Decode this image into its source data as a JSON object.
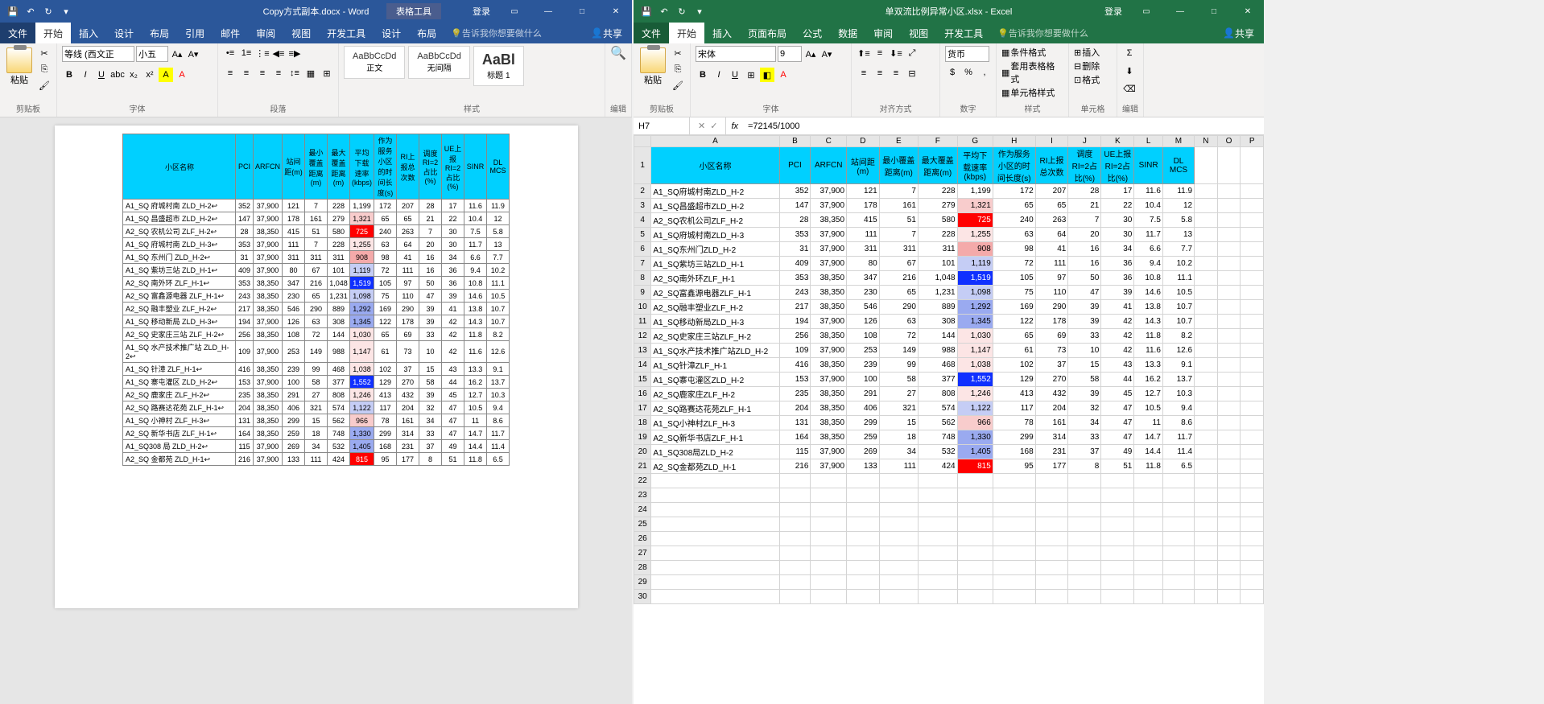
{
  "word": {
    "title": "Copy方式副本.docx - Word",
    "context_tab": "表格工具",
    "login": "登录",
    "menu": {
      "file": "文件",
      "home": "开始",
      "insert": "插入",
      "design": "设计",
      "layout": "布局",
      "references": "引用",
      "mailings": "邮件",
      "review": "审阅",
      "view": "视图",
      "devtools": "开发工具",
      "tbl_design": "设计",
      "tbl_layout": "布局",
      "tell": "告诉我你想要做什么",
      "share": "共享"
    },
    "ribbon": {
      "clipboard": "剪贴板",
      "paste": "粘贴",
      "font": "字体",
      "font_name": "等线 (西文正",
      "font_size": "小五",
      "para": "段落",
      "styles": "样式",
      "editing": "编辑",
      "style_normal_preview": "AaBbCcDd",
      "style_normal": "正文",
      "style_nospace_preview": "AaBbCcDd",
      "style_nospace": "无间隔",
      "style_h1_preview": "AaBl",
      "style_h1": "标题 1"
    }
  },
  "excel": {
    "title": "单双流比例异常小区.xlsx - Excel",
    "login": "登录",
    "menu": {
      "file": "文件",
      "home": "开始",
      "insert": "插入",
      "pagelayout": "页面布局",
      "formulas": "公式",
      "data": "数据",
      "review": "审阅",
      "view": "视图",
      "devtools": "开发工具",
      "tell": "告诉我你想要做什么",
      "share": "共享"
    },
    "ribbon": {
      "clipboard": "剪贴板",
      "paste": "粘贴",
      "font": "字体",
      "font_name": "宋体",
      "font_size": "9",
      "align": "对齐方式",
      "number": "数字",
      "number_fmt": "货币",
      "styles": "样式",
      "cells": "单元格",
      "editing": "编辑",
      "cond_fmt": "条件格式",
      "tbl_fmt": "套用表格格式",
      "cell_style": "单元格样式",
      "ins": "插入",
      "del": "删除",
      "fmt": "格式"
    },
    "name_box": "H7",
    "formula": "=72145/1000",
    "col_letters": [
      "A",
      "B",
      "C",
      "D",
      "E",
      "F",
      "G",
      "H",
      "I",
      "J",
      "K",
      "L",
      "M",
      "N",
      "O",
      "P"
    ]
  },
  "headers": [
    "小区名称",
    "PCI",
    "ARFCN",
    "站间距(m)",
    "最小覆盖距离(m)",
    "最大覆盖距离(m)",
    "平均下载速率(kbps)",
    "作为服务小区的时间长度(s)",
    "RI上报总次数",
    "调度RI=2占比(%)",
    "UE上报RI=2占比(%)",
    "SINR",
    "DL MCS"
  ],
  "rows": [
    {
      "n": "A1_SQ 府城村南 ZLD_H-2",
      "d": [
        352,
        "37,900",
        121,
        7,
        228,
        "1,199",
        172,
        207,
        28,
        17,
        11.6,
        11.9
      ],
      "hl": ""
    },
    {
      "n": "A1_SQ 昌盛超市 ZLD_H-2",
      "d": [
        147,
        "37,900",
        178,
        161,
        279,
        "1,321",
        65,
        65,
        21,
        22,
        10.4,
        12.0
      ],
      "hl": "p2"
    },
    {
      "n": "A2_SQ 农机公司 ZLF_H-2",
      "d": [
        28,
        "38,350",
        415,
        51,
        580,
        "725",
        240,
        263,
        7,
        30,
        7.5,
        5.8
      ],
      "hl": "r"
    },
    {
      "n": "A1_SQ 府城村南 ZLD_H-3",
      "d": [
        353,
        "37,900",
        111,
        7,
        228,
        "1,255",
        63,
        64,
        20,
        30,
        11.7,
        13.0
      ],
      "hl": "p3"
    },
    {
      "n": "A1_SQ 东州门 ZLD_H-2",
      "d": [
        31,
        "37,900",
        311,
        311,
        311,
        "908",
        98,
        41,
        16,
        34,
        6.6,
        7.7
      ],
      "hl": "p1"
    },
    {
      "n": "A1_SQ 紫坊三站 ZLD_H-1",
      "d": [
        409,
        "37,900",
        80,
        67,
        101,
        "1,119",
        72,
        111,
        16,
        36,
        9.4,
        10.2
      ],
      "hl": "b2"
    },
    {
      "n": "A2_SQ 南外环 ZLF_H-1",
      "d": [
        353,
        "38,350",
        347,
        216,
        "1,048",
        "1,519",
        105,
        97,
        50,
        36,
        10.8,
        11.1
      ],
      "hl": "b"
    },
    {
      "n": "A2_SQ 富鑫源电器 ZLF_H-1",
      "d": [
        243,
        "38,350",
        230,
        65,
        "1,231",
        "1,098",
        75,
        110,
        47,
        39,
        14.6,
        10.5
      ],
      "hl": "b2"
    },
    {
      "n": "A2_SQ 融丰塑业 ZLF_H-2",
      "d": [
        217,
        "38,350",
        546,
        290,
        889,
        "1,292",
        169,
        290,
        39,
        41,
        13.8,
        10.7
      ],
      "hl": "b1"
    },
    {
      "n": "A1_SQ 移动新局 ZLD_H-3",
      "d": [
        194,
        "37,900",
        126,
        63,
        308,
        "1,345",
        122,
        178,
        39,
        42,
        14.3,
        10.7
      ],
      "hl": "b1"
    },
    {
      "n": "A2_SQ 史家庄三站 ZLF_H-2",
      "d": [
        256,
        "38,350",
        108,
        72,
        144,
        "1,030",
        65,
        69,
        33,
        42,
        11.8,
        8.2
      ],
      "hl": "p3"
    },
    {
      "n": "A1_SQ 水产技术推广站 ZLD_H-2",
      "d": [
        109,
        "37,900",
        253,
        149,
        988,
        "1,147",
        61,
        73,
        10,
        42,
        11.6,
        12.6
      ],
      "hl": "p3"
    },
    {
      "n": "A1_SQ 针漳 ZLF_H-1",
      "d": [
        416,
        "38,350",
        239,
        99,
        468,
        "1,038",
        102,
        37,
        15,
        43,
        13.3,
        9.1
      ],
      "hl": "p3"
    },
    {
      "n": "A1_SQ 寨屯灌区 ZLD_H-2",
      "d": [
        153,
        "37,900",
        100,
        58,
        377,
        "1,552",
        129,
        270,
        58,
        44,
        16.2,
        13.7
      ],
      "hl": "b"
    },
    {
      "n": "A2_SQ 鹿家庄 ZLF_H-2",
      "d": [
        235,
        "38,350",
        291,
        27,
        808,
        "1,246",
        413,
        432,
        39,
        45,
        12.7,
        10.3
      ],
      "hl": "p3"
    },
    {
      "n": "A2_SQ 路赛达花苑 ZLF_H-1",
      "d": [
        204,
        "38,350",
        406,
        321,
        574,
        "1,122",
        117,
        204,
        32,
        47,
        10.5,
        9.4
      ],
      "hl": "b2"
    },
    {
      "n": "A1_SQ 小神村 ZLF_H-3",
      "d": [
        131,
        "38,350",
        299,
        15,
        562,
        "966",
        78,
        161,
        34,
        47,
        11.0,
        8.6
      ],
      "hl": "p2"
    },
    {
      "n": "A2_SQ 新华书店 ZLF_H-1",
      "d": [
        164,
        "38,350",
        259,
        18,
        748,
        "1,330",
        299,
        314,
        33,
        47,
        14.7,
        11.7
      ],
      "hl": "b1"
    },
    {
      "n": "A1_SQ308 局 ZLD_H-2",
      "d": [
        115,
        "37,900",
        269,
        34,
        532,
        "1,405",
        168,
        231,
        37,
        49,
        14.4,
        11.4
      ],
      "hl": "b1"
    },
    {
      "n": "A2_SQ 金都苑 ZLD_H-1",
      "d": [
        216,
        "37,900",
        133,
        111,
        424,
        "815",
        95,
        177,
        8,
        51,
        11.8,
        6.5
      ],
      "hl": "r"
    }
  ],
  "excel_rows": [
    {
      "n": "A1_SQ府城村南ZLD_H-2",
      "d": [
        352,
        "37,900",
        121,
        7,
        228,
        "1,199",
        172,
        207,
        28,
        17,
        11.6,
        11.9
      ],
      "hl": ""
    },
    {
      "n": "A1_SQ昌盛超市ZLD_H-2",
      "d": [
        147,
        "37,900",
        178,
        161,
        279,
        "1,321",
        65,
        65,
        21,
        22,
        10.4,
        12.0
      ],
      "hl": "p2"
    },
    {
      "n": "A2_SQ农机公司ZLF_H-2",
      "d": [
        28,
        "38,350",
        415,
        51,
        580,
        "725",
        240,
        263,
        7,
        30,
        7.5,
        5.8
      ],
      "hl": "r"
    },
    {
      "n": "A1_SQ府城村南ZLD_H-3",
      "d": [
        353,
        "37,900",
        111,
        7,
        228,
        "1,255",
        63,
        64,
        20,
        30,
        11.7,
        13.0
      ],
      "hl": "p3"
    },
    {
      "n": "A1_SQ东州门ZLD_H-2",
      "d": [
        31,
        "37,900",
        311,
        311,
        311,
        "908",
        98,
        41,
        16,
        34,
        6.6,
        7.7
      ],
      "hl": "p1"
    },
    {
      "n": "A1_SQ紫坊三站ZLD_H-1",
      "d": [
        409,
        "37,900",
        80,
        67,
        101,
        "1,119",
        72,
        111,
        16,
        36,
        9.4,
        10.2
      ],
      "hl": "b2"
    },
    {
      "n": "A2_SQ南外环ZLF_H-1",
      "d": [
        353,
        "38,350",
        347,
        216,
        "1,048",
        "1,519",
        105,
        97,
        50,
        36,
        10.8,
        11.1
      ],
      "hl": "b"
    },
    {
      "n": "A2_SQ富鑫源电器ZLF_H-1",
      "d": [
        243,
        "38,350",
        230,
        65,
        "1,231",
        "1,098",
        75,
        110,
        47,
        39,
        14.6,
        10.5
      ],
      "hl": "b2"
    },
    {
      "n": "A2_SQ融丰塑业ZLF_H-2",
      "d": [
        217,
        "38,350",
        546,
        290,
        889,
        "1,292",
        169,
        290,
        39,
        41,
        13.8,
        10.7
      ],
      "hl": "b1"
    },
    {
      "n": "A1_SQ移动新局ZLD_H-3",
      "d": [
        194,
        "37,900",
        126,
        63,
        308,
        "1,345",
        122,
        178,
        39,
        42,
        14.3,
        10.7
      ],
      "hl": "b1"
    },
    {
      "n": "A2_SQ史家庄三站ZLF_H-2",
      "d": [
        256,
        "38,350",
        108,
        72,
        144,
        "1,030",
        65,
        69,
        33,
        42,
        11.8,
        8.2
      ],
      "hl": "p3"
    },
    {
      "n": "A1_SQ水产技术推广站ZLD_H-2",
      "d": [
        109,
        "37,900",
        253,
        149,
        988,
        "1,147",
        61,
        73,
        10,
        42,
        11.6,
        12.6
      ],
      "hl": "p3"
    },
    {
      "n": "A1_SQ针漳ZLF_H-1",
      "d": [
        416,
        "38,350",
        239,
        99,
        468,
        "1,038",
        102,
        37,
        15,
        43,
        13.3,
        9.1
      ],
      "hl": "p3"
    },
    {
      "n": "A1_SQ寨屯灌区ZLD_H-2",
      "d": [
        153,
        "37,900",
        100,
        58,
        377,
        "1,552",
        129,
        270,
        58,
        44,
        16.2,
        13.7
      ],
      "hl": "b"
    },
    {
      "n": "A2_SQ鹿家庄ZLF_H-2",
      "d": [
        235,
        "38,350",
        291,
        27,
        808,
        "1,246",
        413,
        432,
        39,
        45,
        12.7,
        10.3
      ],
      "hl": "p3"
    },
    {
      "n": "A2_SQ路赛达花苑ZLF_H-1",
      "d": [
        204,
        "38,350",
        406,
        321,
        574,
        "1,122",
        117,
        204,
        32,
        47,
        10.5,
        9.4
      ],
      "hl": "b2"
    },
    {
      "n": "A1_SQ小神村ZLF_H-3",
      "d": [
        131,
        "38,350",
        299,
        15,
        562,
        "966",
        78,
        161,
        34,
        47,
        11.0,
        8.6
      ],
      "hl": "p2"
    },
    {
      "n": "A2_SQ新华书店ZLF_H-1",
      "d": [
        164,
        "38,350",
        259,
        18,
        748,
        "1,330",
        299,
        314,
        33,
        47,
        14.7,
        11.7
      ],
      "hl": "b1"
    },
    {
      "n": "A1_SQ308局ZLD_H-2",
      "d": [
        115,
        "37,900",
        269,
        34,
        532,
        "1,405",
        168,
        231,
        37,
        49,
        14.4,
        11.4
      ],
      "hl": "b1"
    },
    {
      "n": "A2_SQ金都苑ZLD_H-1",
      "d": [
        216,
        "37,900",
        133,
        111,
        424,
        "815",
        95,
        177,
        8,
        51,
        11.8,
        6.5
      ],
      "hl": "r"
    }
  ]
}
